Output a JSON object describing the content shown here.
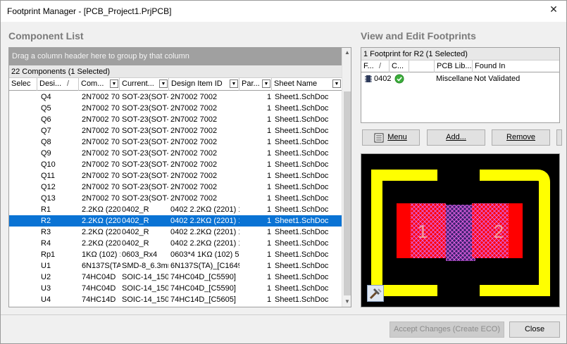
{
  "window": {
    "title": "Footprint Manager - [PCB_Project1.PrjPCB]",
    "close_glyph": "✕"
  },
  "component_list": {
    "title": "Component List",
    "group_hint": "Drag a column header here to group by that column",
    "count_text": "22 Components (1 Selected)",
    "columns": [
      "Selec",
      "Desi...",
      "Com...",
      "Current...",
      "Design Item ID",
      "Par...",
      "Sheet Name"
    ],
    "sort_glyph": "/",
    "filter_glyph": "▼",
    "rows": [
      {
        "designator": "Q4",
        "comment": "2N7002 70",
        "footprint": "SOT-23(SOT-2",
        "design_item_id": "2N7002 7002",
        "parts": "1",
        "sheet": "Sheet1.SchDoc",
        "selected": false
      },
      {
        "designator": "Q5",
        "comment": "2N7002 70",
        "footprint": "SOT-23(SOT-2",
        "design_item_id": "2N7002 7002",
        "parts": "1",
        "sheet": "Sheet1.SchDoc",
        "selected": false
      },
      {
        "designator": "Q6",
        "comment": "2N7002 70",
        "footprint": "SOT-23(SOT-2",
        "design_item_id": "2N7002 7002",
        "parts": "1",
        "sheet": "Sheet1.SchDoc",
        "selected": false
      },
      {
        "designator": "Q7",
        "comment": "2N7002 70",
        "footprint": "SOT-23(SOT-2",
        "design_item_id": "2N7002 7002",
        "parts": "1",
        "sheet": "Sheet1.SchDoc",
        "selected": false
      },
      {
        "designator": "Q8",
        "comment": "2N7002 70",
        "footprint": "SOT-23(SOT-2",
        "design_item_id": "2N7002 7002",
        "parts": "1",
        "sheet": "Sheet1.SchDoc",
        "selected": false
      },
      {
        "designator": "Q9",
        "comment": "2N7002 70",
        "footprint": "SOT-23(SOT-2",
        "design_item_id": "2N7002 7002",
        "parts": "1",
        "sheet": "Sheet1.SchDoc",
        "selected": false
      },
      {
        "designator": "Q10",
        "comment": "2N7002 70",
        "footprint": "SOT-23(SOT-2",
        "design_item_id": "2N7002 7002",
        "parts": "1",
        "sheet": "Sheet1.SchDoc",
        "selected": false
      },
      {
        "designator": "Q11",
        "comment": "2N7002 70",
        "footprint": "SOT-23(SOT-2",
        "design_item_id": "2N7002 7002",
        "parts": "1",
        "sheet": "Sheet1.SchDoc",
        "selected": false
      },
      {
        "designator": "Q12",
        "comment": "2N7002 70",
        "footprint": "SOT-23(SOT-2",
        "design_item_id": "2N7002 7002",
        "parts": "1",
        "sheet": "Sheet1.SchDoc",
        "selected": false
      },
      {
        "designator": "Q13",
        "comment": "2N7002 70",
        "footprint": "SOT-23(SOT-2",
        "design_item_id": "2N7002 7002",
        "parts": "1",
        "sheet": "Sheet1.SchDoc",
        "selected": false
      },
      {
        "designator": "R1",
        "comment": "2.2KΩ (220",
        "footprint": "0402_R",
        "design_item_id": "0402 2.2KΩ (2201) 1",
        "parts": "1",
        "sheet": "Sheet1.SchDoc",
        "selected": false
      },
      {
        "designator": "R2",
        "comment": "2.2KΩ (220",
        "footprint": "0402_R",
        "design_item_id": "0402 2.2KΩ (2201) 1",
        "parts": "1",
        "sheet": "Sheet1.SchDoc",
        "selected": true
      },
      {
        "designator": "R3",
        "comment": "2.2KΩ (220",
        "footprint": "0402_R",
        "design_item_id": "0402 2.2KΩ (2201) 1",
        "parts": "1",
        "sheet": "Sheet1.SchDoc",
        "selected": false
      },
      {
        "designator": "R4",
        "comment": "2.2KΩ (220",
        "footprint": "0402_R",
        "design_item_id": "0402 2.2KΩ (2201) 1",
        "parts": "1",
        "sheet": "Sheet1.SchDoc",
        "selected": false
      },
      {
        "designator": "Rp1",
        "comment": "1KΩ (102) :",
        "footprint": "0603_Rx4",
        "design_item_id": "0603*4  1KΩ (102) 5",
        "parts": "1",
        "sheet": "Sheet1.SchDoc",
        "selected": false
      },
      {
        "designator": "U1",
        "comment": "6N137S(TA",
        "footprint": "SMD-8_6.3mr",
        "design_item_id": "6N137S(TA)_[C1649(",
        "parts": "1",
        "sheet": "Sheet1.SchDoc",
        "selected": false
      },
      {
        "designator": "U2",
        "comment": "74HC04D",
        "footprint": "SOIC-14_150(",
        "design_item_id": "74HC04D_[C5590]",
        "parts": "1",
        "sheet": "Sheet1.SchDoc",
        "selected": false
      },
      {
        "designator": "U3",
        "comment": "74HC04D",
        "footprint": "SOIC-14_150(",
        "design_item_id": "74HC04D_[C5590]",
        "parts": "1",
        "sheet": "Sheet1.SchDoc",
        "selected": false
      },
      {
        "designator": "U4",
        "comment": "74HC14D",
        "footprint": "SOIC-14_150(",
        "design_item_id": "74HC14D_[C5605]",
        "parts": "1",
        "sheet": "Sheet1.SchDoc",
        "selected": false
      }
    ]
  },
  "footprints": {
    "title": "View and Edit Footprints",
    "count_text": "1 Footprint for R2 (1 Selected)",
    "columns": [
      "F...",
      "C...",
      "PCB Lib...",
      "Found In"
    ],
    "sort_glyph": "/",
    "row": {
      "name": "0402",
      "pcb_lib": "Miscellane",
      "found_in": "Not Validated"
    },
    "buttons": {
      "menu": "Menu",
      "add": "Add...",
      "remove": "Remove"
    }
  },
  "preview": {
    "pad_labels": [
      "1",
      "2"
    ],
    "colors": {
      "background": "#000000",
      "silkscreen": "#ffff00",
      "pad": "#ff0000",
      "pad_hatch": "#e060e0",
      "body": "#3a1e6e",
      "pad_label": "#f0a0a0"
    }
  },
  "footer": {
    "accept": "Accept Changes (Create ECO)",
    "close": "Close"
  },
  "colors": {
    "selection": "#0a73d4",
    "section_title": "#7a7a7a",
    "group_panel": "#a0a0a0"
  }
}
